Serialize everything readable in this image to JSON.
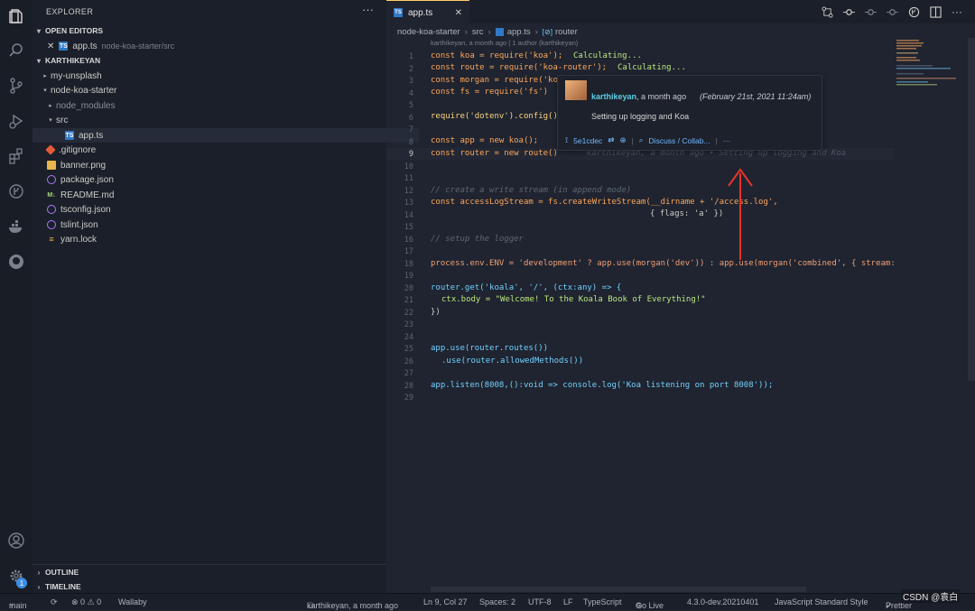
{
  "explorer": {
    "title": "EXPLORER",
    "more": "···",
    "open_editors": {
      "label": "OPEN EDITORS",
      "items": [
        {
          "close": "✕",
          "name": "app.ts",
          "path": "node-koa-starter/src"
        }
      ]
    },
    "workspace": {
      "label": "KARTHIKEYAN",
      "tree": [
        {
          "name": "my-unsplash"
        },
        {
          "name": "node-koa-starter"
        },
        {
          "name": "node_modules"
        },
        {
          "name": "src"
        },
        {
          "name": "app.ts"
        },
        {
          "name": ".gitignore"
        },
        {
          "name": "banner.png"
        },
        {
          "name": "package.json"
        },
        {
          "name": "README.md"
        },
        {
          "name": "tsconfig.json"
        },
        {
          "name": "tslint.json"
        },
        {
          "name": "yarn.lock"
        }
      ]
    },
    "outline": "OUTLINE",
    "timeline": "TIMELINE"
  },
  "activity": {
    "badge": "1"
  },
  "tab": {
    "label": "app.ts",
    "close": "✕"
  },
  "breadcrumbs": [
    "node-koa-starter",
    "src",
    "app.ts",
    "router"
  ],
  "editor": {
    "blame_header": "karthikeyan, a month ago | 1 author (karthikeyan)",
    "line_numbers": [
      "1",
      "2",
      "3",
      "4",
      "5",
      "6",
      "7",
      "8",
      "9",
      "10",
      "11",
      "12",
      "13",
      "14",
      "15",
      "16",
      "17",
      "18",
      "19",
      "20",
      "21",
      "22",
      "23",
      "24",
      "25",
      "26",
      "27",
      "28",
      "29"
    ],
    "current_line": "9",
    "inline_blame": "karthikeyan, a month ago • Setting up logging and Koa",
    "calculating": "Calculating...",
    "lines": {
      "l1": "const koa = require('koa');",
      "l2": "const route = require('koa-router');",
      "l3": "const morgan = require('ko",
      "l4": "const fs = require('fs')",
      "l6": "require('dotenv').config()",
      "l8": "const app = new koa();",
      "l9": "const router = new route()",
      "l12": "// create a write stream (in append mode)",
      "l13": "const accessLogStream = fs.createWriteStream(__dirname + '/access.log',",
      "l14": "{ flags: 'a' })",
      "l16": "// setup the logger",
      "l18": "process.env.ENV = 'development' ? app.use(morgan('dev')) : app.use(morgan('combined', { stream:",
      "l20": "router.get('koala', '/', (ctx:any) => {",
      "l21": "ctx.body = \"Welcome! To the Koala Book of Everything!\"",
      "l22": "})",
      "l25": "app.use(router.routes())",
      "l26": ".use(router.allowedMethods())",
      "l28": "app.listen(8008,():void => console.log('Koa listening on port 8008'));"
    }
  },
  "hover": {
    "author": "karthikeyan",
    "when": ", a month ago",
    "date": "(February 21st, 2021 11:24am)",
    "message": "Setting up logging and Koa",
    "commit": "5e1cdec",
    "discuss": "Discuss / Collab...",
    "sep": "|",
    "more": "···"
  },
  "status": {
    "branch": "main",
    "problems": "⊗ 0 ⚠ 0",
    "wallaby": "Wallaby",
    "blame": "karthikeyan, a month ago",
    "position": "Ln 9, Col 27",
    "spaces": "Spaces: 2",
    "encoding": "UTF-8",
    "eol": "LF",
    "language": "TypeScript",
    "golive": "Go Live",
    "version": "4.3.0-dev.20210401",
    "style": "JavaScript Standard Style",
    "prettier": "Prettier",
    "watermark": "CSDN @袁白"
  },
  "colors": {
    "accent": "#ffcc66",
    "link": "#73b8ff",
    "annotation": "#e8322a"
  }
}
